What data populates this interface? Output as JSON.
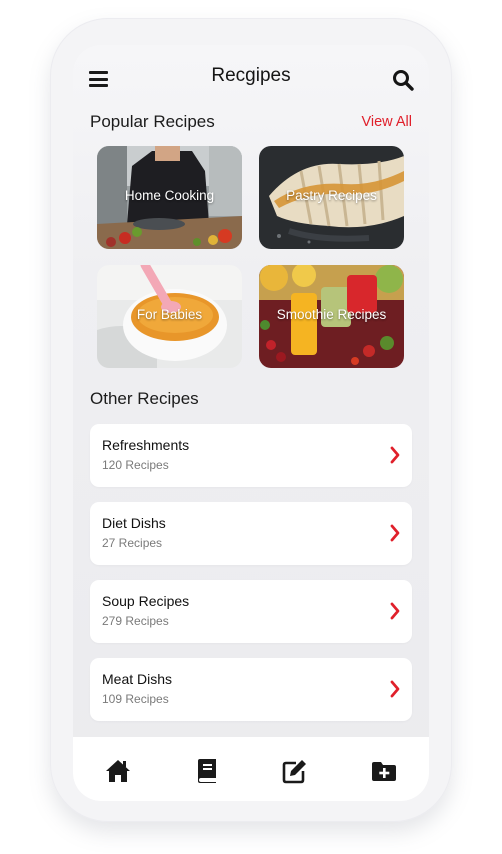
{
  "header": {
    "title": "Recgipes",
    "menu_icon": "hamburger-menu-icon",
    "search_icon": "search-icon"
  },
  "popular": {
    "title": "Popular Recipes",
    "view_all": "View All",
    "accent": "#e0202b",
    "cards": [
      {
        "label": "Home Cooking",
        "image": "chef-cooking-kitchen"
      },
      {
        "label": "Pastry Recipes",
        "image": "croissants-with-syrup"
      },
      {
        "label": "For Babies",
        "image": "baby-food-bowl-with-spoon"
      },
      {
        "label": "Smoothie Recipes",
        "image": "fruit-smoothies"
      }
    ]
  },
  "other": {
    "title": "Other Recipes",
    "items": [
      {
        "name": "Refreshments",
        "count": "120 Recipes"
      },
      {
        "name": "Diet Dishs",
        "count": "27 Recipes"
      },
      {
        "name": "Soup Recipes",
        "count": "279 Recipes"
      },
      {
        "name": "Meat Dishs",
        "count": "109 Recipes"
      }
    ]
  },
  "nav": {
    "items": [
      "home-icon",
      "book-icon",
      "edit-icon",
      "folder-add-icon"
    ]
  }
}
